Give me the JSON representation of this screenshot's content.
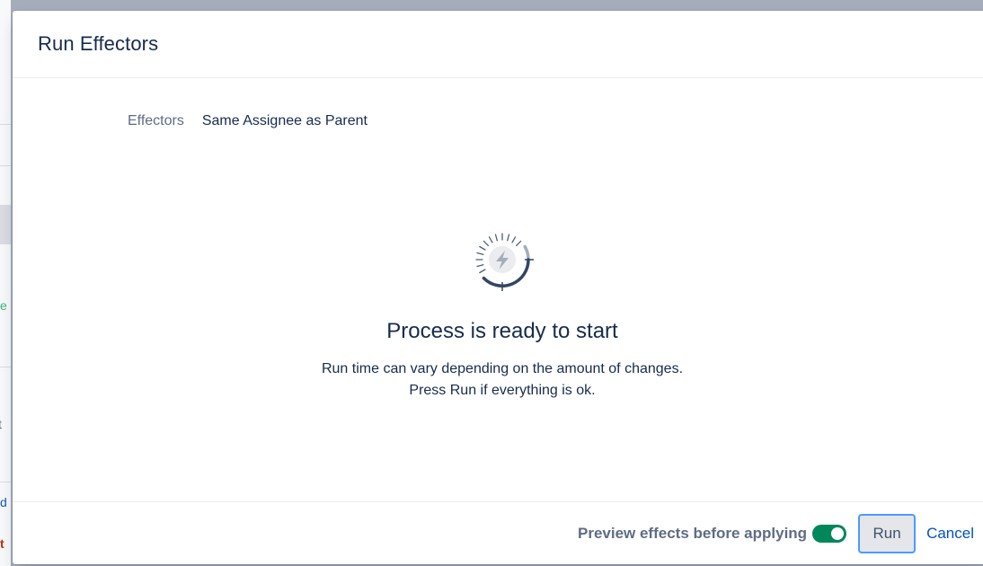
{
  "dialog": {
    "title": "Run Effectors"
  },
  "field": {
    "label": "Effectors",
    "value": "Same Assignee as Parent"
  },
  "status": {
    "icon": "lightning-gauge-icon",
    "title": "Process is ready to start",
    "line1": "Run time can vary depending on the amount of changes.",
    "line2": "Press Run if everything is ok."
  },
  "footer": {
    "toggle_label": "Preview effects before applying",
    "toggle_on": true,
    "run_label": "Run",
    "cancel_label": "Cancel"
  },
  "background": {
    "fragments": [
      "e",
      "t",
      "d",
      "t"
    ]
  },
  "colors": {
    "toggle_on": "#00875a",
    "link": "#0052cc",
    "text": "#172b4d",
    "muted": "#5e6c84",
    "focus_ring": "#4c9aff"
  }
}
